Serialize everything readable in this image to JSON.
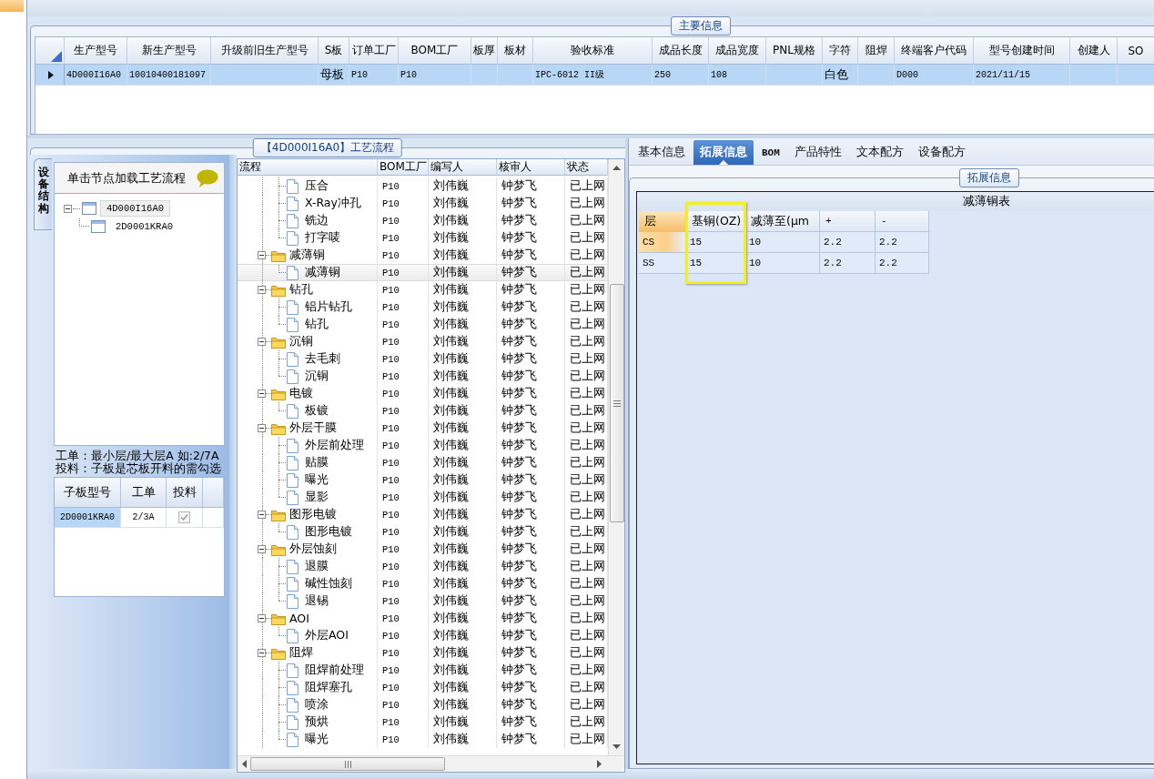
{
  "main_info": {
    "title": "主要信息",
    "columns": [
      "生产型号",
      "新生产型号",
      "升级前旧生产型号",
      "S板",
      "订单工厂",
      "BOM工厂",
      "板厚",
      "板材",
      "验收标准",
      "成品长度",
      "成品宽度",
      "PNL规格",
      "字符",
      "阻焊",
      "终端客户代码",
      "型号创建时间",
      "创建人",
      "SO"
    ],
    "rows": [
      {
        "selected": true,
        "cells": [
          "4D000I16A0",
          "10010400181097",
          "",
          "母板",
          "P10",
          "P10",
          "",
          "",
          "IPC-6012 II级",
          "250",
          "108",
          "",
          "白色",
          "",
          "D000",
          "2021/11/15",
          "",
          ""
        ]
      }
    ]
  },
  "process_panel": {
    "title": "【4D000I16A0】工艺流程",
    "side_tab": {
      "label": "设备结构",
      "selected": true
    },
    "hint": "单击节点加载工艺流程",
    "structure_tree": [
      {
        "label": "4D000I16A0",
        "expanded": true,
        "selected": true,
        "children": [
          {
            "label": "2D0001KRA0",
            "selected": false
          }
        ]
      }
    ],
    "notes": [
      "工单：最小层/最大层A 如:2/7A",
      "投料：子板是芯板开料的需勾选"
    ],
    "sub_boards": {
      "columns": [
        "子板型号",
        "工单",
        "投料"
      ],
      "rows": [
        {
          "board": "2D0001KRA0",
          "work_order": "2/3A",
          "feed": true,
          "selected": true
        }
      ]
    },
    "flow": {
      "columns": [
        "流程",
        "BOM工厂",
        "编写人",
        "核审人",
        "状态"
      ],
      "nodes": [
        {
          "kind": "folder",
          "children": [
            {
              "kind": "step",
              "label": "压合",
              "bom": "P10",
              "author": "刘伟巍",
              "reviewer": "钟梦飞",
              "status": "已上网",
              "selected": false
            },
            {
              "kind": "step",
              "label": "X-Ray冲孔",
              "bom": "P10",
              "author": "刘伟巍",
              "reviewer": "钟梦飞",
              "status": "已上网",
              "selected": false
            },
            {
              "kind": "step",
              "label": "铣边",
              "bom": "P10",
              "author": "刘伟巍",
              "reviewer": "钟梦飞",
              "status": "已上网",
              "selected": false
            },
            {
              "kind": "step",
              "label": "打字唛",
              "bom": "P10",
              "author": "刘伟巍",
              "reviewer": "钟梦飞",
              "status": "已上网",
              "selected": false
            }
          ]
        },
        {
          "kind": "folder",
          "label": "减薄铜",
          "bom": "P10",
          "author": "刘伟巍",
          "reviewer": "钟梦飞",
          "status": "已上网",
          "selected": false,
          "expanded": true,
          "children": [
            {
              "kind": "step",
              "label": "减薄铜",
              "bom": "P10",
              "author": "刘伟巍",
              "reviewer": "钟梦飞",
              "status": "已上网",
              "selected": true
            }
          ]
        },
        {
          "kind": "folder",
          "label": "钻孔",
          "bom": "P10",
          "author": "刘伟巍",
          "reviewer": "钟梦飞",
          "status": "已上网",
          "selected": false,
          "expanded": true,
          "children": [
            {
              "kind": "step",
              "label": "铝片钻孔",
              "bom": "P10",
              "author": "刘伟巍",
              "reviewer": "钟梦飞",
              "status": "已上网",
              "selected": false
            },
            {
              "kind": "step",
              "label": "钻孔",
              "bom": "P10",
              "author": "刘伟巍",
              "reviewer": "钟梦飞",
              "status": "已上网",
              "selected": false
            }
          ]
        },
        {
          "kind": "folder",
          "label": "沉铜",
          "bom": "P10",
          "author": "刘伟巍",
          "reviewer": "钟梦飞",
          "status": "已上网",
          "selected": false,
          "expanded": true,
          "children": [
            {
              "kind": "step",
              "label": "去毛刺",
              "bom": "P10",
              "author": "刘伟巍",
              "reviewer": "钟梦飞",
              "status": "已上网",
              "selected": false
            },
            {
              "kind": "step",
              "label": "沉铜",
              "bom": "P10",
              "author": "刘伟巍",
              "reviewer": "钟梦飞",
              "status": "已上网",
              "selected": false
            }
          ]
        },
        {
          "kind": "folder",
          "label": "电镀",
          "bom": "P10",
          "author": "刘伟巍",
          "reviewer": "钟梦飞",
          "status": "已上网",
          "selected": false,
          "expanded": true,
          "children": [
            {
              "kind": "step",
              "label": "板镀",
              "bom": "P10",
              "author": "刘伟巍",
              "reviewer": "钟梦飞",
              "status": "已上网",
              "selected": false
            }
          ]
        },
        {
          "kind": "folder",
          "label": "外层干膜",
          "bom": "P10",
          "author": "刘伟巍",
          "reviewer": "钟梦飞",
          "status": "已上网",
          "selected": false,
          "expanded": true,
          "children": [
            {
              "kind": "step",
              "label": "外层前处理",
              "bom": "P10",
              "author": "刘伟巍",
              "reviewer": "钟梦飞",
              "status": "已上网",
              "selected": false
            },
            {
              "kind": "step",
              "label": "贴膜",
              "bom": "P10",
              "author": "刘伟巍",
              "reviewer": "钟梦飞",
              "status": "已上网",
              "selected": false
            },
            {
              "kind": "step",
              "label": "曝光",
              "bom": "P10",
              "author": "刘伟巍",
              "reviewer": "钟梦飞",
              "status": "已上网",
              "selected": false
            },
            {
              "kind": "step",
              "label": "显影",
              "bom": "P10",
              "author": "刘伟巍",
              "reviewer": "钟梦飞",
              "status": "已上网",
              "selected": false
            }
          ]
        },
        {
          "kind": "folder",
          "label": "图形电镀",
          "bom": "P10",
          "author": "刘伟巍",
          "reviewer": "钟梦飞",
          "status": "已上网",
          "selected": false,
          "expanded": true,
          "children": [
            {
              "kind": "step",
              "label": "图形电镀",
              "bom": "P10",
              "author": "刘伟巍",
              "reviewer": "钟梦飞",
              "status": "已上网",
              "selected": false
            }
          ]
        },
        {
          "kind": "folder",
          "label": "外层蚀刻",
          "bom": "P10",
          "author": "刘伟巍",
          "reviewer": "钟梦飞",
          "status": "已上网",
          "selected": false,
          "expanded": true,
          "children": [
            {
              "kind": "step",
              "label": "退膜",
              "bom": "P10",
              "author": "刘伟巍",
              "reviewer": "钟梦飞",
              "status": "已上网",
              "selected": false
            },
            {
              "kind": "step",
              "label": "碱性蚀刻",
              "bom": "P10",
              "author": "刘伟巍",
              "reviewer": "钟梦飞",
              "status": "已上网",
              "selected": false
            },
            {
              "kind": "step",
              "label": "退锡",
              "bom": "P10",
              "author": "刘伟巍",
              "reviewer": "钟梦飞",
              "status": "已上网",
              "selected": false
            }
          ]
        },
        {
          "kind": "folder",
          "label": "AOI",
          "bom": "P10",
          "author": "刘伟巍",
          "reviewer": "钟梦飞",
          "status": "已上网",
          "selected": false,
          "expanded": true,
          "children": [
            {
              "kind": "step",
              "label": "外层AOI",
              "bom": "P10",
              "author": "刘伟巍",
              "reviewer": "钟梦飞",
              "status": "已上网",
              "selected": false
            }
          ]
        },
        {
          "kind": "folder",
          "label": "阻焊",
          "bom": "P10",
          "author": "刘伟巍",
          "reviewer": "钟梦飞",
          "status": "已上网",
          "selected": false,
          "expanded": true,
          "children": [
            {
              "kind": "step",
              "label": "阻焊前处理",
              "bom": "P10",
              "author": "刘伟巍",
              "reviewer": "钟梦飞",
              "status": "已上网",
              "selected": false
            },
            {
              "kind": "step",
              "label": "阻焊塞孔",
              "bom": "P10",
              "author": "刘伟巍",
              "reviewer": "钟梦飞",
              "status": "已上网",
              "selected": false
            },
            {
              "kind": "step",
              "label": "喷涂",
              "bom": "P10",
              "author": "刘伟巍",
              "reviewer": "钟梦飞",
              "status": "已上网",
              "selected": false
            },
            {
              "kind": "step",
              "label": "预烘",
              "bom": "P10",
              "author": "刘伟巍",
              "reviewer": "钟梦飞",
              "status": "已上网",
              "selected": false
            },
            {
              "kind": "step",
              "label": "曝光",
              "bom": "P10",
              "author": "刘伟巍",
              "reviewer": "钟梦飞",
              "status": "已上网",
              "selected": false
            }
          ]
        }
      ]
    }
  },
  "detail": {
    "tabs": [
      {
        "label": "基本信息",
        "selected": false
      },
      {
        "label": "拓展信息",
        "selected": true
      },
      {
        "label": "BOM",
        "selected": false
      },
      {
        "label": "产品特性",
        "selected": false
      },
      {
        "label": "文本配方",
        "selected": false
      },
      {
        "label": "设备配方",
        "selected": false
      }
    ],
    "group_title": "拓展信息",
    "table": {
      "title": "减薄铜表",
      "columns": [
        {
          "heading": "层",
          "highlighted": false
        },
        {
          "heading": "基铜(OZ)",
          "highlighted": true
        },
        {
          "heading": "减薄至(μm",
          "highlighted": false
        },
        {
          "heading": "+",
          "highlighted": false
        },
        {
          "heading": "-",
          "highlighted": false
        }
      ],
      "rows": [
        {
          "selected": true,
          "cells": [
            "CS",
            "15",
            "10",
            "2.2",
            "2.2"
          ]
        },
        {
          "selected": false,
          "cells": [
            "SS",
            "15",
            "10",
            "2.2",
            "2.2"
          ]
        }
      ]
    }
  }
}
